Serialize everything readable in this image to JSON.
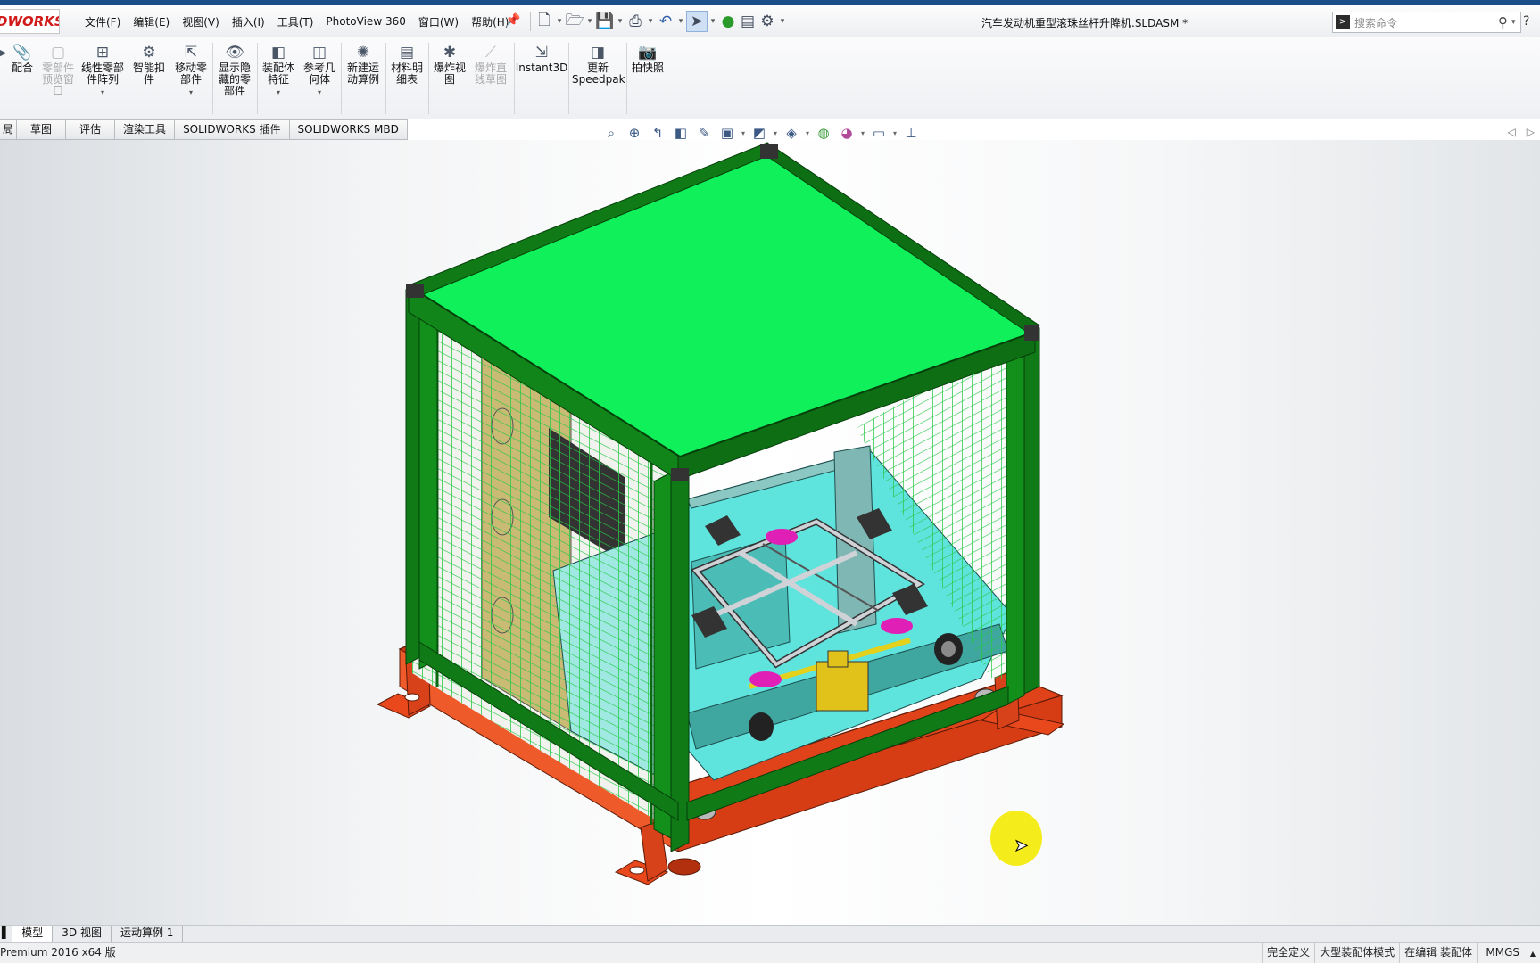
{
  "app": {
    "logo_text": "DWORKS",
    "document_title": "汽车发动机重型滚珠丝杆升降机.SLDASM *"
  },
  "menu": [
    "文件(F)",
    "编辑(E)",
    "视图(V)",
    "插入(I)",
    "工具(T)",
    "PhotoView 360",
    "窗口(W)",
    "帮助(H)"
  ],
  "search": {
    "placeholder": "搜索命令"
  },
  "ribbon": {
    "items": [
      {
        "label": "配合",
        "icon": "paperclip-icon",
        "glyph": "📎",
        "enabled": true
      },
      {
        "label": "零部件预览窗口",
        "icon": "component-preview-icon",
        "glyph": "▢",
        "enabled": false
      },
      {
        "label": "线性零部件阵列",
        "icon": "linear-pattern-icon",
        "glyph": "⊞",
        "enabled": true,
        "dropdown": true
      },
      {
        "label": "智能扣件",
        "icon": "smart-fastener-icon",
        "glyph": "⚙",
        "enabled": true
      },
      {
        "label": "移动零部件",
        "icon": "move-component-icon",
        "glyph": "⇱",
        "enabled": true,
        "dropdown": true
      },
      {
        "label": "显示隐藏的零部件",
        "icon": "show-hidden-icon",
        "glyph": "👁",
        "enabled": true
      },
      {
        "label": "装配体特征",
        "icon": "assembly-feature-icon",
        "glyph": "◧",
        "enabled": true,
        "dropdown": true
      },
      {
        "label": "参考几何体",
        "icon": "reference-geometry-icon",
        "glyph": "◫",
        "enabled": true,
        "dropdown": true
      },
      {
        "label": "新建运动算例",
        "icon": "motion-study-icon",
        "glyph": "✺",
        "enabled": true
      },
      {
        "label": "材料明细表",
        "icon": "bom-icon",
        "glyph": "▤",
        "enabled": true
      },
      {
        "label": "爆炸视图",
        "icon": "explode-view-icon",
        "glyph": "✱",
        "enabled": true
      },
      {
        "label": "爆炸直线草图",
        "icon": "explode-line-icon",
        "glyph": "⟋",
        "enabled": false
      },
      {
        "label": "Instant3D",
        "icon": "instant3d-icon",
        "glyph": "⇲",
        "enabled": true
      },
      {
        "label": "更新Speedpak",
        "icon": "speedpak-icon",
        "glyph": "◨",
        "enabled": true
      },
      {
        "label": "拍快照",
        "icon": "camera-icon",
        "glyph": "📷",
        "enabled": true
      }
    ]
  },
  "command_tabs": [
    "局",
    "草图",
    "评估",
    "渲染工具",
    "SOLIDWORKS 插件",
    "SOLIDWORKS MBD"
  ],
  "bottom_tabs": [
    "模型",
    "3D 视图",
    "运动算例 1"
  ],
  "status": {
    "left": "Premium 2016 x64 版",
    "items": [
      "完全定义",
      "大型装配体模式",
      "在编辑 装配体",
      "MMGS"
    ]
  },
  "colors": {
    "frame_green": "#0f7a16",
    "roof_green": "#10f05a",
    "base_orange": "#e8481c",
    "mesh_green": "#2bd24a",
    "platform_cyan": "#5fe3dd",
    "cursor_highlight": "#f5ec1c"
  }
}
